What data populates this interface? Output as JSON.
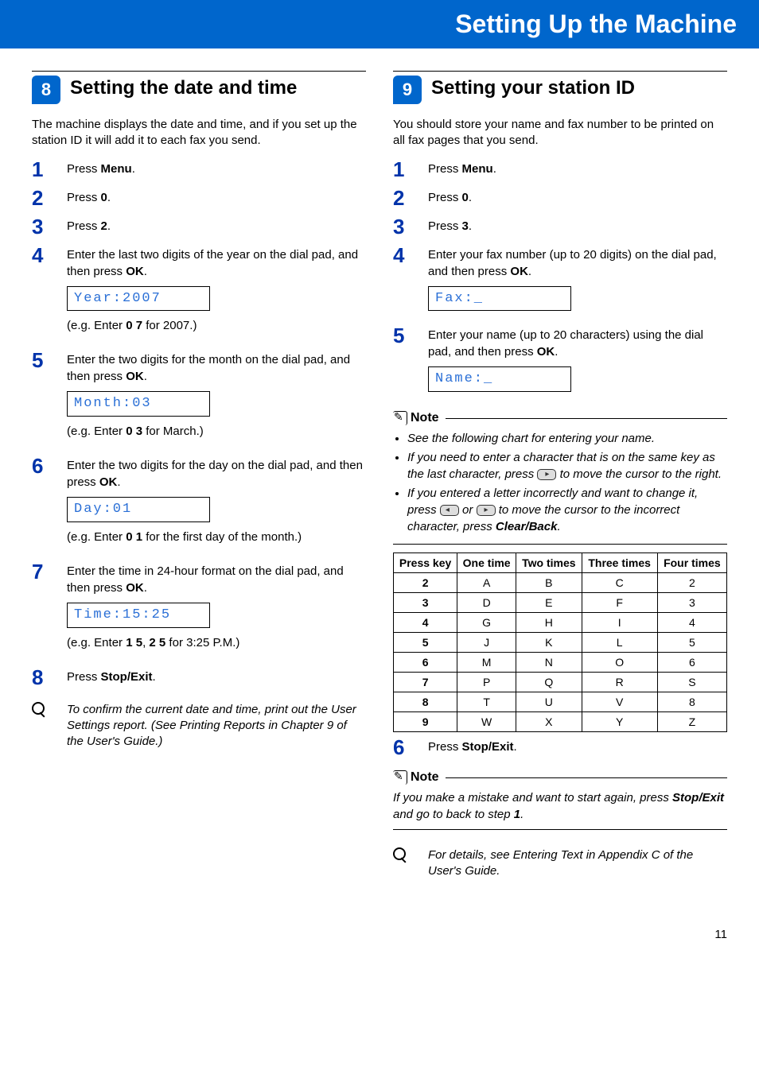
{
  "banner": "Setting Up the Machine",
  "page_number": "11",
  "left": {
    "num": "8",
    "title": "Setting the date and time",
    "intro": "The machine displays the date and time, and if you set up the station ID it will add it to each fax you send.",
    "s1": {
      "pre": "Press ",
      "b": "Menu",
      "post": "."
    },
    "s2": {
      "pre": "Press ",
      "b": "0",
      "post": "."
    },
    "s3": {
      "pre": "Press ",
      "b": "2",
      "post": "."
    },
    "s4": {
      "t1": "Enter the last two digits of the year on the dial pad, and then press ",
      "b1": "OK",
      "t2": ".",
      "lcd": "Year:2007",
      "eg_pre": "(e.g. Enter ",
      "eg_b": "0 7",
      "eg_post": " for 2007.)"
    },
    "s5": {
      "t1": "Enter the two digits for the month on the dial pad, and then press ",
      "b1": "OK",
      "t2": ".",
      "lcd": "Month:03",
      "eg_pre": "(e.g. Enter ",
      "eg_b": "0 3",
      "eg_post": " for March.)"
    },
    "s6": {
      "t1": "Enter the two digits for the day on the dial pad, and then press ",
      "b1": "OK",
      "t2": ".",
      "lcd": "Day:01",
      "eg_pre": "(e.g. Enter ",
      "eg_b": "0 1",
      "eg_post": " for the first day of the month.)"
    },
    "s7": {
      "t1": "Enter the time in 24-hour format on the dial pad, and then press ",
      "b1": "OK",
      "t2": ".",
      "lcd": "Time:15:25",
      "eg_pre": "(e.g. Enter ",
      "eg_b1": "1 5",
      "eg_mid": ", ",
      "eg_b2": "2 5",
      "eg_post": " for 3:25 P.M.)"
    },
    "s8": {
      "pre": "Press ",
      "b": "Stop/Exit",
      "post": "."
    },
    "tip": "To confirm the current date and time, print out the User Settings report. (See Printing Reports in Chapter 9 of the User's Guide.)"
  },
  "right": {
    "num": "9",
    "title": "Setting your station ID",
    "intro": "You should store your name and fax number to be printed on all fax pages that you send.",
    "s1": {
      "pre": "Press ",
      "b": "Menu",
      "post": "."
    },
    "s2": {
      "pre": "Press ",
      "b": "0",
      "post": "."
    },
    "s3": {
      "pre": "Press ",
      "b": "3",
      "post": "."
    },
    "s4": {
      "t1": "Enter your fax number (up to 20 digits) on the dial pad, and then press ",
      "b1": "OK",
      "t2": ".",
      "lcd": "Fax:_"
    },
    "s5": {
      "t1": "Enter your name (up to 20 characters) using the dial pad, and then press ",
      "b1": "OK",
      "t2": ".",
      "lcd": "Name:_"
    },
    "note_label": "Note",
    "note1_a": "See the following chart for entering your name.",
    "note1_b_pre": "If you need to enter a character that is on the same key as the last character, press ",
    "note1_b_post": " to move the cursor to the right.",
    "note1_c_pre": "If you entered a letter incorrectly and want to change it, press ",
    "note1_c_mid": " or ",
    "note1_c_post": " to move the cursor to the incorrect character, press ",
    "note1_c_b": "Clear/Back",
    "note1_c_end": ".",
    "s6": {
      "pre": "Press ",
      "b": "Stop/Exit",
      "post": "."
    },
    "note2_pre": "If you make a mistake and want to start again, press ",
    "note2_b": "Stop/Exit",
    "note2_mid": " and go to back to step ",
    "note2_step": "1",
    "note2_end": ".",
    "tip": "For details, see Entering Text in Appendix C of the User's Guide."
  },
  "chart_data": {
    "type": "table",
    "headers": [
      "Press key",
      "One time",
      "Two times",
      "Three times",
      "Four times"
    ],
    "rows": [
      [
        "2",
        "A",
        "B",
        "C",
        "2"
      ],
      [
        "3",
        "D",
        "E",
        "F",
        "3"
      ],
      [
        "4",
        "G",
        "H",
        "I",
        "4"
      ],
      [
        "5",
        "J",
        "K",
        "L",
        "5"
      ],
      [
        "6",
        "M",
        "N",
        "O",
        "6"
      ],
      [
        "7",
        "P",
        "Q",
        "R",
        "S"
      ],
      [
        "8",
        "T",
        "U",
        "V",
        "8"
      ],
      [
        "9",
        "W",
        "X",
        "Y",
        "Z"
      ]
    ]
  }
}
